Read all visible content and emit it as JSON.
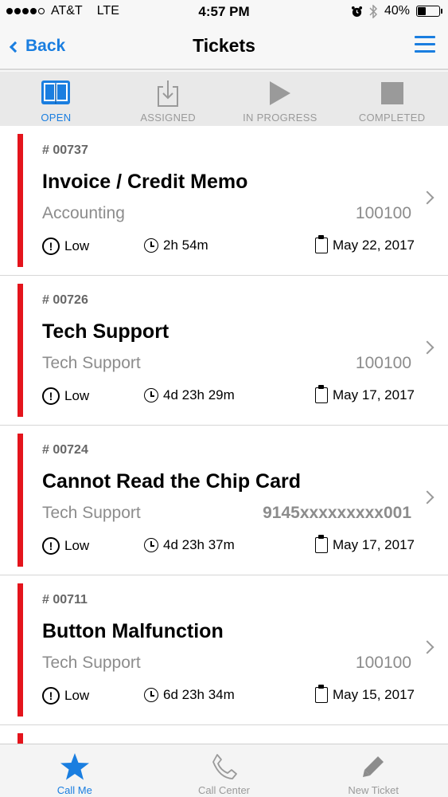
{
  "status_bar": {
    "carrier": "AT&T",
    "network": "LTE",
    "time": "4:57 PM",
    "battery": "40%",
    "battery_level": 0.4
  },
  "nav": {
    "back_label": "Back",
    "title": "Tickets"
  },
  "filter_tabs": [
    {
      "label": "OPEN",
      "icon": "book-icon",
      "active": true
    },
    {
      "label": "ASSIGNED",
      "icon": "download-tray-icon",
      "active": false
    },
    {
      "label": "IN PROGRESS",
      "icon": "play-icon",
      "active": false
    },
    {
      "label": "COMPLETED",
      "icon": "stop-icon",
      "active": false
    }
  ],
  "tickets": [
    {
      "number": "# 00737",
      "title": "Invoice / Credit Memo",
      "department": "Accounting",
      "reference": "100100",
      "priority": "Low",
      "elapsed": "2h 54m",
      "date": "May 22, 2017"
    },
    {
      "number": "# 00726",
      "title": "Tech Support",
      "department": "Tech Support",
      "reference": "100100",
      "priority": "Low",
      "elapsed": "4d 23h 29m",
      "date": "May 17, 2017"
    },
    {
      "number": "# 00724",
      "title": "Cannot Read the Chip Card",
      "department": "Tech Support",
      "reference": "9145xxxxxxxxx001",
      "priority": "Low",
      "elapsed": "4d 23h 37m",
      "date": "May 17, 2017"
    },
    {
      "number": "# 00711",
      "title": "Button Malfunction",
      "department": "Tech Support",
      "reference": "100100",
      "priority": "Low",
      "elapsed": "6d 23h 34m",
      "date": "May 15, 2017"
    }
  ],
  "bottom_tabs": [
    {
      "label": "Call Me",
      "icon": "star-icon",
      "active": true
    },
    {
      "label": "Call Center",
      "icon": "phone-icon",
      "active": false
    },
    {
      "label": "New Ticket",
      "icon": "pencil-icon",
      "active": false
    }
  ],
  "colors": {
    "accent": "#1a7ee0",
    "ticket_bar": "#e4141c",
    "inactive": "#9a9a9a"
  }
}
